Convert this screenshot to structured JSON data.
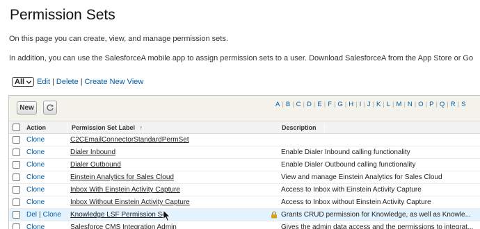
{
  "page": {
    "title": "Permission Sets",
    "intro": "On this page you can create, view, and manage permission sets.",
    "info": "In addition, you can use the SalesforceA mobile app to assign permission sets to a user. Download SalesforceA from the App Store or Go"
  },
  "view_bar": {
    "selected_view": "All",
    "edit": "Edit",
    "delete": "Delete",
    "create": "Create New View",
    "separator": "|"
  },
  "toolbar": {
    "new_label": "New",
    "refresh_icon": "refresh-icon",
    "alphabet": [
      "A",
      "B",
      "C",
      "D",
      "E",
      "F",
      "G",
      "H",
      "I",
      "J",
      "K",
      "L",
      "M",
      "N",
      "O",
      "P",
      "Q",
      "R",
      "S"
    ]
  },
  "table": {
    "headers": {
      "action": "Action",
      "label": "Permission Set Label",
      "sort_indicator": "↑",
      "description": "Description"
    },
    "rows": [
      {
        "action": "Clone",
        "label": "C2CEmailConnectorStandardPermSet",
        "description": ""
      },
      {
        "action": "Clone",
        "label": "Dialer Inbound",
        "description": "Enable Dialer Inbound calling functionality"
      },
      {
        "action": "Clone",
        "label": "Dialer Outbound",
        "description": "Enable Dialer Outbound calling functionality"
      },
      {
        "action": "Clone",
        "label": "Einstein Analytics for Sales Cloud",
        "description": "View and manage Einstein Analytics for Sales Cloud"
      },
      {
        "action": "Clone",
        "label": "Inbox With Einstein Activity Capture",
        "description": "Access to Inbox with Einstein Activity Capture"
      },
      {
        "action": "Clone",
        "label": "Inbox Without Einstein Activity Capture",
        "description": "Access to Inbox without Einstein Activity Capture"
      },
      {
        "action_del": "Del",
        "action_sep": "|",
        "action": "Clone",
        "label": "Knowledge LSF Permission Se",
        "description": "Grants CRUD permission for Knowledge, as well as Knowle...",
        "locked": true,
        "highlighted": true
      },
      {
        "action": "Clone",
        "label": "Salesforce CMS Integration Admin",
        "description": "Gives the admin data access and the permissions to integrat..."
      }
    ]
  },
  "colors": {
    "link": "#015ba7",
    "panel_bg": "#f3f3ec",
    "row_highlight": "#e3f3ff",
    "lock_gold": "#d6a21c"
  }
}
